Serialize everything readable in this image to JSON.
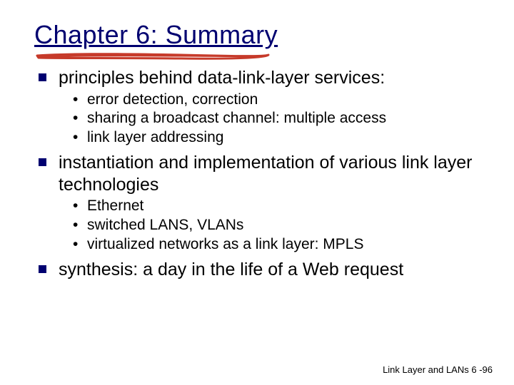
{
  "title": "Chapter 6: Summary",
  "bullets": [
    {
      "text": "principles behind data-link-layer services:",
      "sub": [
        "error detection, correction",
        "sharing a broadcast channel: multiple access",
        "link layer addressing"
      ]
    },
    {
      "text": "instantiation and implementation of various link layer technologies",
      "sub": [
        "Ethernet",
        "switched LANS, VLANs",
        "virtualized networks as a link layer: MPLS"
      ]
    },
    {
      "text": "synthesis: a day in the life of a Web request",
      "sub": []
    }
  ],
  "footer": "Link Layer and LANs  6 -96"
}
